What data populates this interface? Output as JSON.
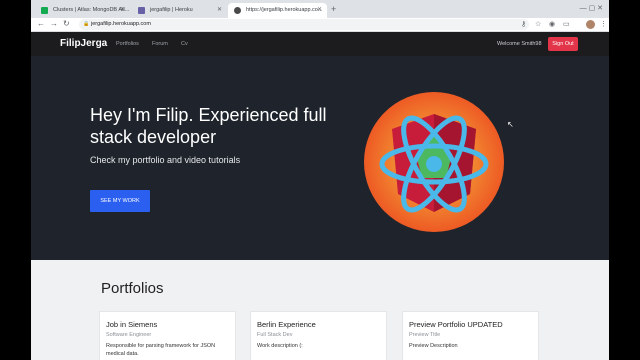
{
  "browser": {
    "tabs": [
      {
        "label": "Clusters | Atlas: MongoDB Atl...",
        "favicon_color": "#13aa52",
        "active": false
      },
      {
        "label": "jergafilip | Heroku",
        "favicon_color": "#6762a6",
        "active": false
      },
      {
        "label": "https://jergafilip.herokuapp.co...",
        "favicon_color": "#4a4a4a",
        "active": true
      }
    ],
    "new_tab_icon": "plus-icon",
    "url": "jergafilip.herokuapp.com"
  },
  "site": {
    "brand": "FilipJerga",
    "nav": [
      "Portfolios",
      "Forum",
      "Cv"
    ],
    "welcome": "Welcome Smith98",
    "signout": "Sign Out",
    "accent": "#e2354a"
  },
  "hero": {
    "title": "Hey I'm Filip. Experienced full stack developer",
    "subtitle": "Check my portfolio and video tutorials",
    "cta": "SEE MY WORK",
    "cta_color": "#2b5ff0"
  },
  "portfolios": {
    "title": "Portfolios",
    "cards": [
      {
        "title": "Job in Siemens",
        "subtitle": "Software Engineer",
        "description": "Responsible for parsing framework for JSON medical data."
      },
      {
        "title": "Berlin Experience",
        "subtitle": "Full Stack Dev",
        "description": "Work description (:"
      },
      {
        "title": "Preview Portfolio UPDATED",
        "subtitle": "Preview Title",
        "description": "Preview Description"
      }
    ]
  }
}
